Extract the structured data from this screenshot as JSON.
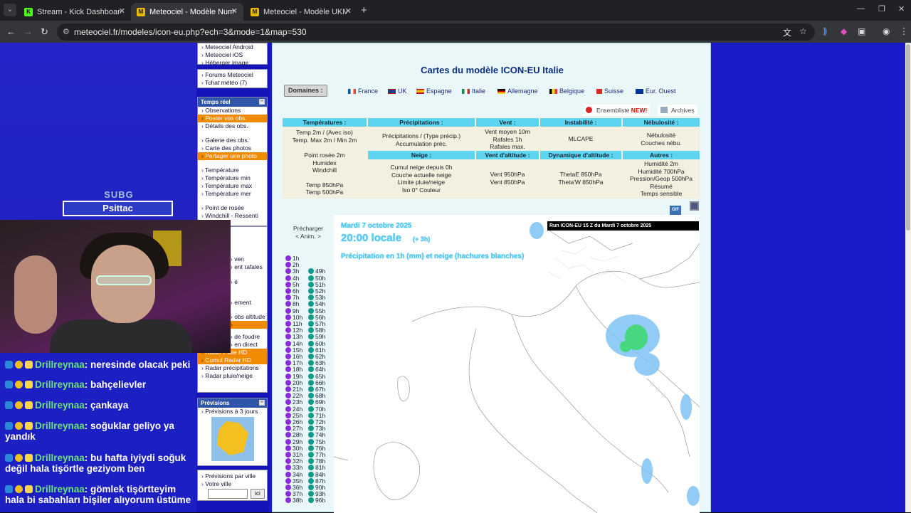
{
  "browser": {
    "tabs": [
      {
        "title": "Stream - Kick Dashboard",
        "active": false,
        "fav": "K"
      },
      {
        "title": "Meteociel - Modèle Numérique",
        "active": true,
        "fav": "M"
      },
      {
        "title": "Meteociel - Modèle UKMO pou",
        "active": false,
        "fav": "M"
      }
    ],
    "url": "meteociel.fr/modeles/icon-eu.php?ech=3&mode=1&map=530"
  },
  "stream": {
    "badge_top": "SUBG",
    "badge_name": "Psittac",
    "chat": [
      {
        "user": "Drillreynaa",
        "msg": "neresinde olacak peki"
      },
      {
        "user": "Drillreynaa",
        "msg": "bahçelievler"
      },
      {
        "user": "Drillreynaa",
        "msg": "çankaya"
      },
      {
        "user": "Drillreynaa",
        "msg": "soğuklar geliyo ya yandık"
      },
      {
        "user": "Drillreynaa",
        "msg": "bu hafta iyiydi soğuk değil hala tişörtle geziyom ben"
      },
      {
        "user": "Drillreynaa",
        "msg": "gömlek tişörtteyim hala bi sabahları bişiler alıyorum üstüme"
      }
    ]
  },
  "sidebar": {
    "top_items": [
      "Meteociel Android",
      "Meteociel iOS",
      "Héberger image"
    ],
    "forum_items": [
      "Forums Meteociel",
      "Tchat météo (7)"
    ],
    "temps_reel_title": "Temps réel",
    "temps_reel_items": [
      "Observations",
      "Poster vos obs.",
      "Détails des obs.",
      "",
      "Galerie des obs.",
      "Carte des photos",
      "Partager une photo",
      "",
      "Température",
      "Température min",
      "Température max",
      "Température mer",
      "",
      "Point de rosée",
      "Windchill - Ressenti"
    ],
    "lower_items": [
      "ven",
      "ent rafales",
      "",
      "é",
      "",
      "ement",
      "",
      "obs altitude",
      "",
      "",
      "de foudre",
      "en direct",
      "Radar Pluie HD",
      "Cumul Radar HD",
      "Radar précipitations",
      "Radar pluie/neige"
    ],
    "previsions_title": "Prévisions",
    "previsions_items": [
      "Prévisions à 3 jours"
    ],
    "ville_items": [
      "Prévisions par ville",
      "Votre ville"
    ],
    "ici_label": "ici"
  },
  "content": {
    "title": "Cartes du modèle ICON-EU Italie",
    "domains_label": "Domaines :",
    "countries": [
      "France",
      "UK",
      "Espagne",
      "Italie",
      "Allemagne",
      "Belgique",
      "Suisse",
      "Eur. Ouest"
    ],
    "ensembliste": "Ensembliste",
    "new": "NEW!",
    "archives": "Archives",
    "params": {
      "h_temp": "Températures :",
      "h_precip": "Précipitations :",
      "h_vent": "Vent :",
      "h_instab": "Instabilité :",
      "h_nebu": "Nébulosité :",
      "temp1": "Temp.2m / (Avec iso)",
      "temp2": "Temp. Max 2m / Min 2m",
      "prec1": "Précipitations / (Type précip.)",
      "prec2": "Accumulation préc.",
      "vent1": "Vent moyen 10m",
      "vent2": "Rafales 1h",
      "vent3": "Rafales max.",
      "instab1": "MLCAPE",
      "nebu1": "Nébulosité",
      "nebu2": "Couches nébu.",
      "temp3": "Point rosée 2m",
      "temp4": "Humidex",
      "temp5": "Windchill",
      "temp6": "Temp 850hPa",
      "temp7": "Temp 500hPa",
      "h_neige": "Neige :",
      "h_valt": "Vent d'altitude :",
      "h_dyn": "Dynamique d'altitude :",
      "h_autres": "Autres :",
      "neige1": "Cumul neige depuis 0h",
      "neige2": "Couche actuelle neige",
      "neige3": "Limite pluie/neige",
      "neige4": "Iso 0° Couleur",
      "valt1": "Vent 950hPa",
      "valt2": "Vent 850hPa",
      "dyn1": "ThetaE 850hPa",
      "dyn2": "Theta'W 850hPa",
      "aut1": "Humidité 2m",
      "aut2": "Humidité 700hPa",
      "aut3": "Pression/Geop 500hPa",
      "aut4": "Résumé",
      "aut5": "Temps sensible"
    },
    "anim_label": "Précharger",
    "anim_sub": "< Anim. >",
    "hours_left": [
      "1h",
      "2h",
      "3h",
      "4h",
      "5h",
      "6h",
      "7h",
      "8h",
      "9h",
      "10h",
      "11h",
      "12h",
      "13h",
      "14h",
      "15h",
      "16h",
      "17h",
      "18h",
      "19h",
      "20h",
      "21h",
      "22h",
      "23h",
      "24h",
      "25h",
      "26h",
      "27h",
      "28h",
      "29h",
      "30h",
      "31h",
      "32h",
      "33h",
      "34h",
      "35h",
      "36h",
      "37h",
      "38h"
    ],
    "hours_right": [
      "49h",
      "50h",
      "51h",
      "52h",
      "53h",
      "54h",
      "55h",
      "56h",
      "57h",
      "58h",
      "59h",
      "60h",
      "61h",
      "62h",
      "63h",
      "64h",
      "65h",
      "66h",
      "67h",
      "68h",
      "69h",
      "70h",
      "71h",
      "72h",
      "73h",
      "74h",
      "75h",
      "76h",
      "77h",
      "78h",
      "81h",
      "84h",
      "87h",
      "90h",
      "93h",
      "96h"
    ],
    "map": {
      "run": "Run ICON-EU 15 Z du Mardi 7 octobre 2025",
      "date": "Mardi 7 octobre 2025",
      "time": "20:00 locale",
      "offset": "(+ 3h)",
      "legend": "Précipitation en 1h (mm) et neige (hachures blanches)"
    }
  },
  "colors": {
    "page_bg": "#1a1ac8",
    "content_bg": "#e9f7f9",
    "header_cyan": "#5dd5f0",
    "orange": "#f08a00",
    "chat_user": "#6fe07a"
  }
}
